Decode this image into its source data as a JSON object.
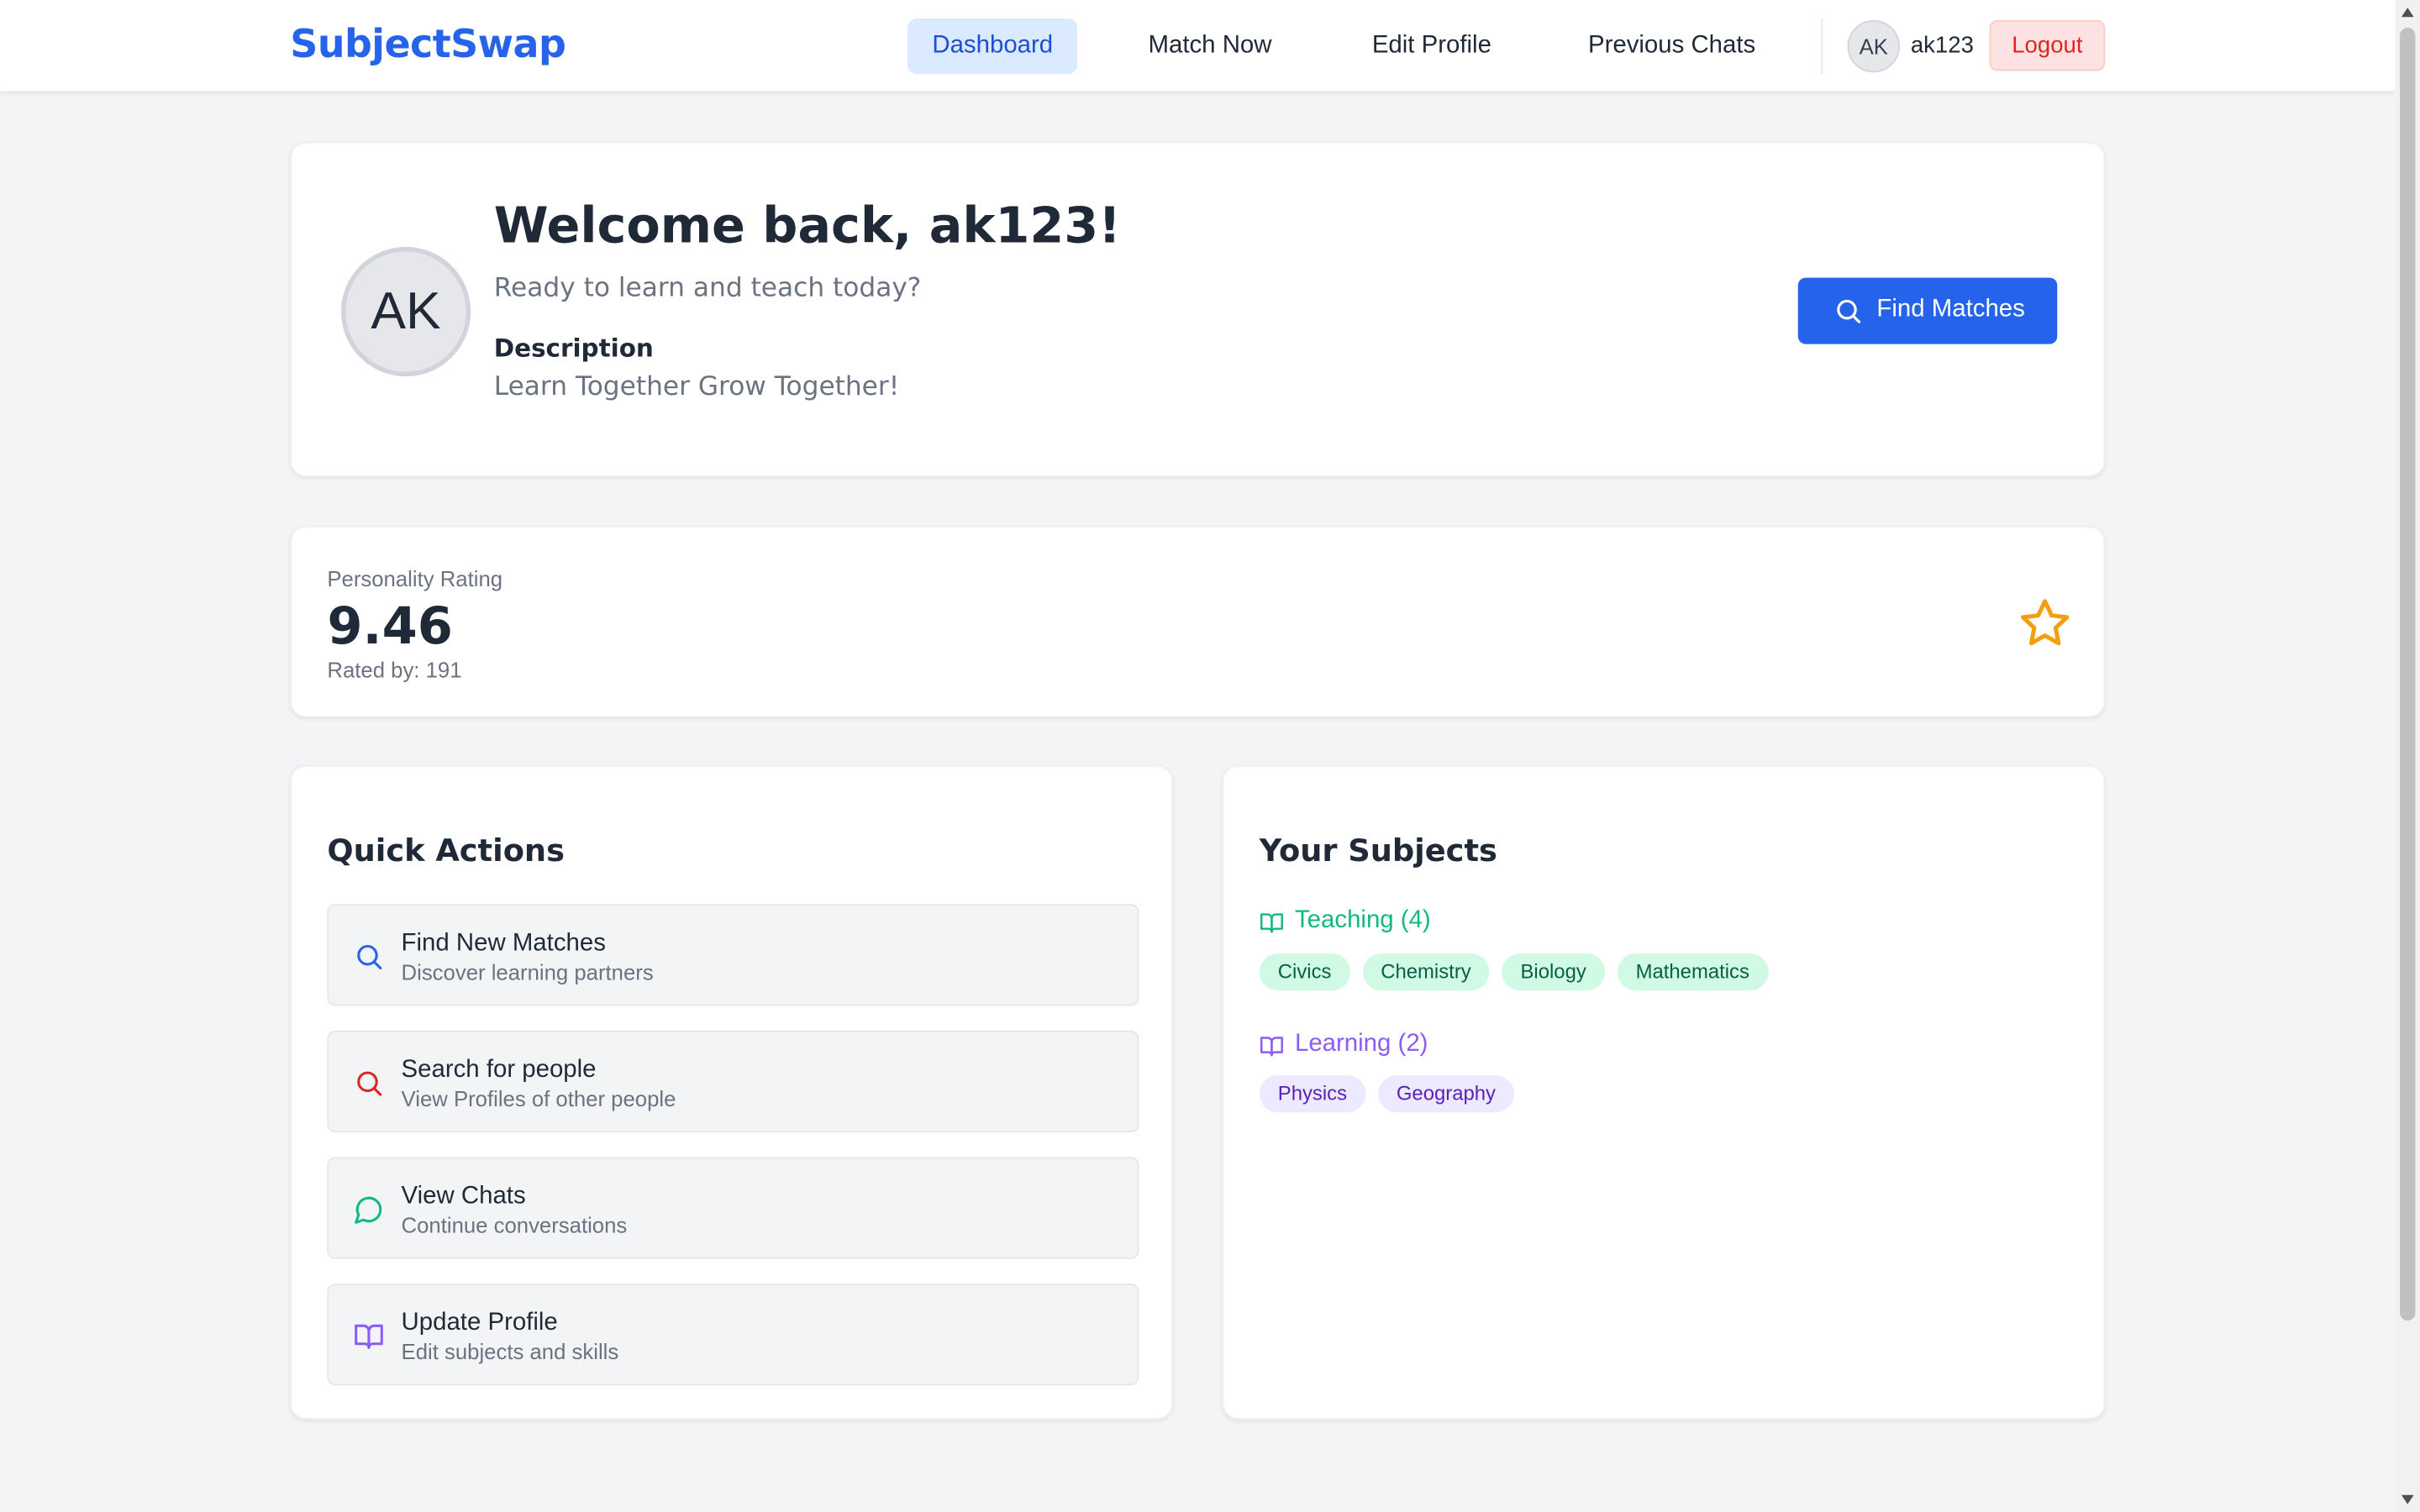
{
  "header": {
    "brand": "SubjectSwap",
    "nav": [
      {
        "label": "Dashboard",
        "active": true
      },
      {
        "label": "Match Now",
        "active": false
      },
      {
        "label": "Edit Profile",
        "active": false
      },
      {
        "label": "Previous Chats",
        "active": false
      }
    ],
    "user": {
      "initials": "AK",
      "username": "ak123"
    },
    "logout_label": "Logout"
  },
  "welcome": {
    "avatar_initials": "AK",
    "title": "Welcome back, ak123!",
    "subtitle": "Ready to learn and teach today?",
    "description_label": "Description",
    "description": "Learn Together Grow Together!",
    "find_button_label": "Find Matches",
    "find_button_icon": "search-icon"
  },
  "rating": {
    "label": "Personality Rating",
    "value": "9.46",
    "count_text": "Rated by: 191",
    "icon": "star-icon"
  },
  "quick_actions": {
    "title": "Quick Actions",
    "items": [
      {
        "title": "Find New Matches",
        "description": "Discover learning partners",
        "icon": "search-icon",
        "color": "#2563eb"
      },
      {
        "title": "Search for people",
        "description": "View Profiles of other people",
        "icon": "search-icon",
        "color": "#dc2626"
      },
      {
        "title": "View Chats",
        "description": "Continue conversations",
        "icon": "chat-bubble-icon",
        "color": "#10b981"
      },
      {
        "title": "Update Profile",
        "description": "Edit subjects and skills",
        "icon": "book-open-icon",
        "color": "#8b5cf6"
      }
    ]
  },
  "subjects": {
    "title": "Your Subjects",
    "teaching": {
      "label": "Teaching (4)",
      "icon": "book-open-icon",
      "color": "#10b981",
      "items": [
        "Civics",
        "Chemistry",
        "Biology",
        "Mathematics"
      ]
    },
    "learning": {
      "label": "Learning (2)",
      "icon": "book-open-icon",
      "color": "#8b5cf6",
      "items": [
        "Physics",
        "Geography"
      ]
    }
  },
  "colors": {
    "brand": "#2563eb",
    "background": "#f3f4f6",
    "logout": "#dc2626",
    "rating_star": "#f59e0b"
  }
}
